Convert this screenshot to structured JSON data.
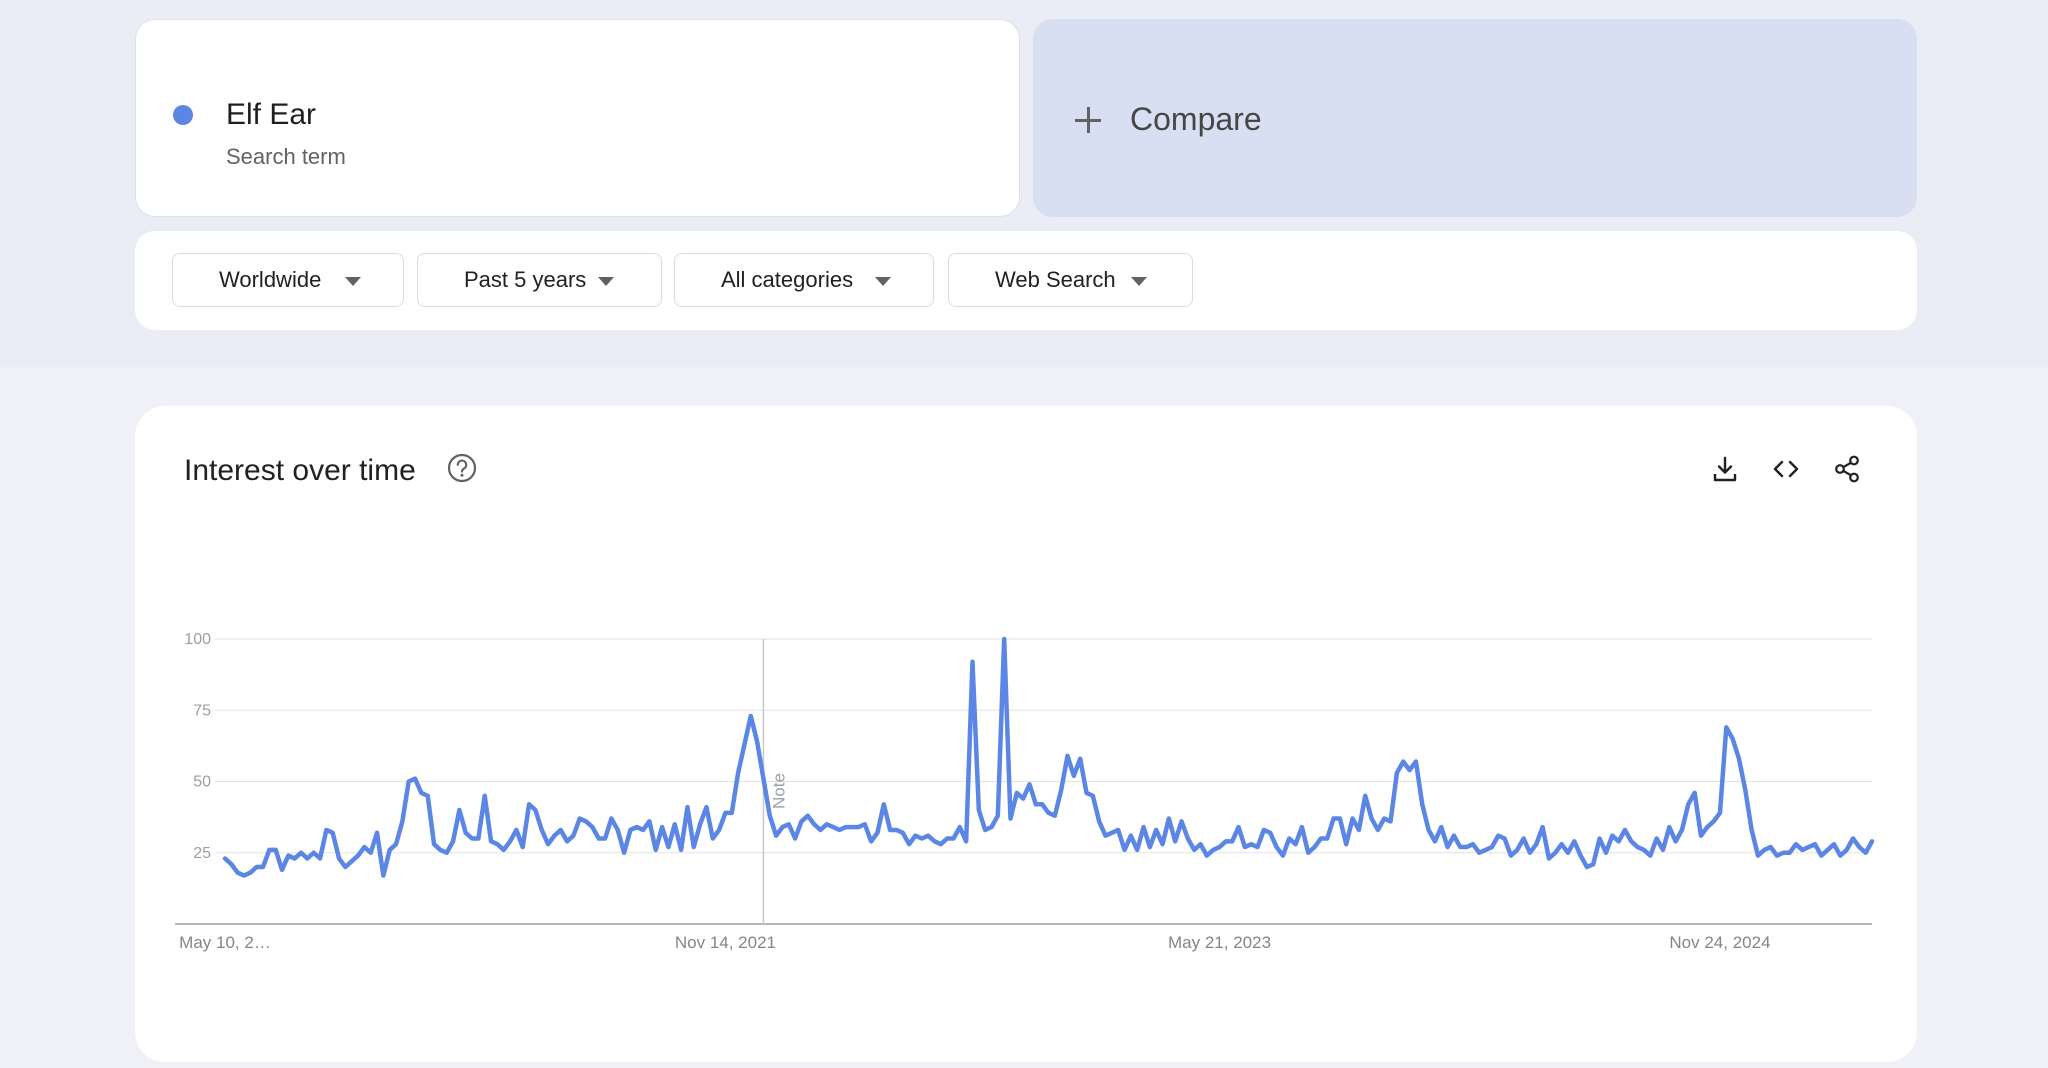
{
  "search_term": {
    "name": "Elf Ear",
    "subtitle": "Search term",
    "color": "#5b86e5"
  },
  "compare": {
    "label": "Compare",
    "icon": "plus-icon"
  },
  "filters": {
    "region": "Worldwide",
    "time_range": "Past 5 years",
    "category": "All categories",
    "search_type": "Web Search"
  },
  "chart_card": {
    "title": "Interest over time",
    "help_icon": "help-circle-icon",
    "tools": [
      "download-icon",
      "embed-code-icon",
      "share-icon"
    ],
    "note_label": "Note"
  },
  "chart_data": {
    "type": "line",
    "title": "Interest over time",
    "ylim": [
      0,
      100
    ],
    "yticks": [
      100,
      75,
      50,
      25
    ],
    "grid": true,
    "x_tick_labels": [
      "May 10, 2…",
      "Nov 14, 2021",
      "May 21, 2023",
      "Nov 24, 2024"
    ],
    "x_tick_index": [
      0,
      79,
      157,
      236
    ],
    "note_index": 85,
    "series": [
      {
        "color": "#5b86e5",
        "values": [
          23,
          21,
          18,
          17,
          18,
          20,
          20,
          26,
          26,
          19,
          24,
          23,
          25,
          23,
          25,
          23,
          33,
          32,
          23,
          20,
          22,
          24,
          27,
          25,
          32,
          17,
          26,
          28,
          36,
          50,
          51,
          46,
          45,
          28,
          26,
          25,
          29,
          40,
          32,
          30,
          30,
          45,
          29,
          28,
          26,
          29,
          33,
          27,
          42,
          40,
          33,
          28,
          31,
          33,
          29,
          31,
          37,
          36,
          34,
          30,
          30,
          37,
          33,
          25,
          33,
          34,
          33,
          36,
          26,
          34,
          27,
          35,
          26,
          41,
          27,
          35,
          41,
          30,
          33,
          39,
          39,
          53,
          63,
          73,
          64,
          51,
          38,
          31,
          34,
          35,
          30,
          36,
          38,
          35,
          33,
          35,
          34,
          33,
          34,
          34,
          34,
          35,
          29,
          32,
          42,
          33,
          33,
          32,
          28,
          31,
          30,
          31,
          29,
          28,
          30,
          30,
          34,
          29,
          92,
          40,
          33,
          34,
          38,
          100,
          37,
          46,
          44,
          49,
          42,
          42,
          39,
          38,
          47,
          59,
          52,
          58,
          46,
          45,
          36,
          31,
          32,
          33,
          26,
          31,
          26,
          34,
          27,
          33,
          28,
          37,
          29,
          36,
          30,
          26,
          28,
          24,
          26,
          27,
          29,
          29,
          34,
          27,
          28,
          27,
          33,
          32,
          27,
          24,
          30,
          28,
          34,
          25,
          27,
          30,
          30,
          37,
          37,
          28,
          37,
          33,
          45,
          37,
          33,
          37,
          36,
          53,
          57,
          54,
          57,
          42,
          33,
          29,
          34,
          27,
          31,
          27,
          27,
          28,
          25,
          26,
          27,
          31,
          30,
          24,
          26,
          30,
          25,
          28,
          34,
          23,
          25,
          28,
          25,
          29,
          24,
          20,
          21,
          30,
          25,
          31,
          29,
          33,
          29,
          27,
          26,
          24,
          30,
          26,
          34,
          29,
          33,
          42,
          46,
          31,
          34,
          36,
          39,
          69,
          65,
          58,
          47,
          33,
          24,
          26,
          27,
          24,
          25,
          25,
          28,
          26,
          27,
          28,
          24,
          26,
          28,
          24,
          26,
          30,
          27,
          25,
          29
        ]
      }
    ]
  }
}
